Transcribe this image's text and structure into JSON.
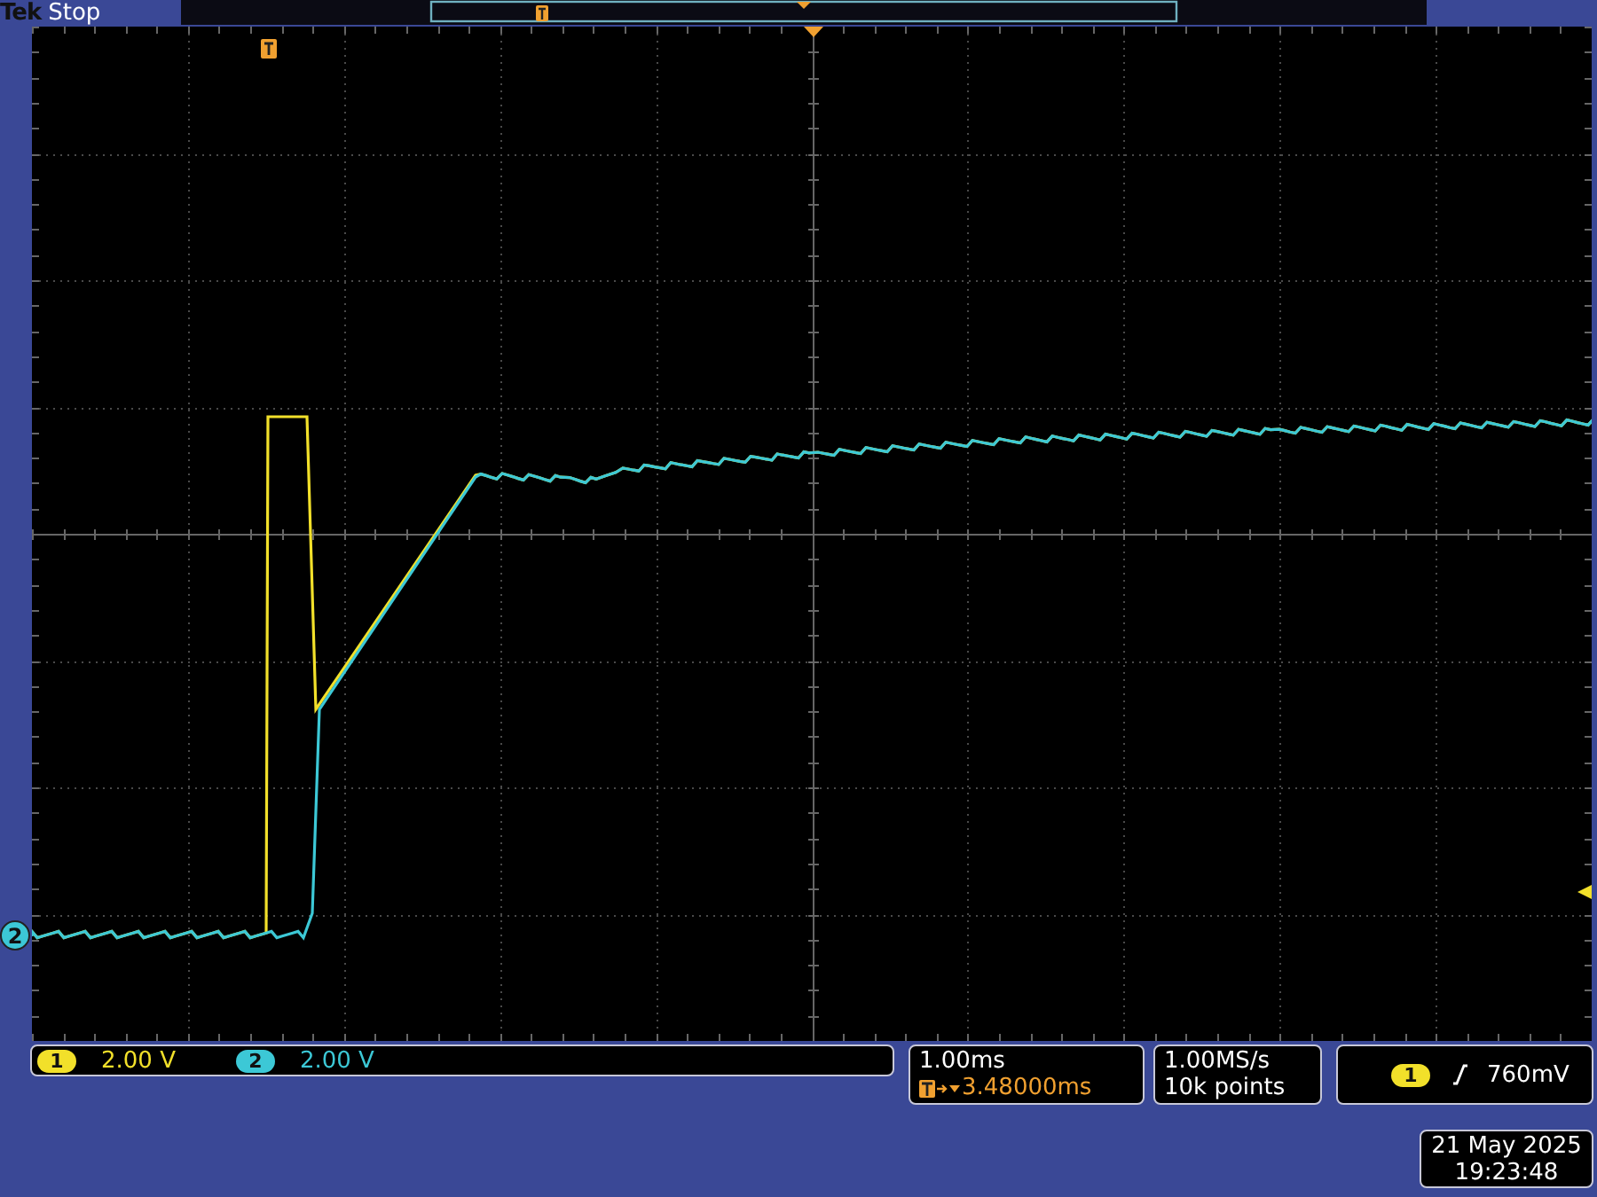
{
  "status": {
    "brand": "Tek",
    "state": "Stop"
  },
  "channels": [
    {
      "number": "1",
      "scale": "2.00 V",
      "color": "#f2e02a"
    },
    {
      "number": "2",
      "scale": "2.00 V",
      "color": "#3cc8d6"
    }
  ],
  "waveform_marker": "2",
  "timebase": {
    "scale": "1.00ms",
    "trigger_position": "3.48000ms"
  },
  "acquisition": {
    "sample_rate": "1.00MS/s",
    "record_length": "10k points"
  },
  "trigger": {
    "source": "1",
    "level": "760mV"
  },
  "datetime": {
    "date": "21 May 2025",
    "time": "19:23:48"
  }
}
